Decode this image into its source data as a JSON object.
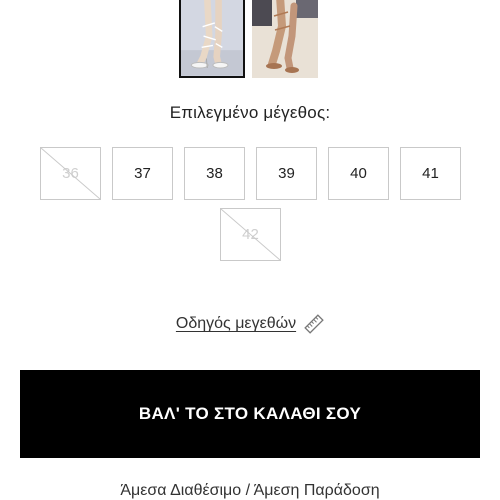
{
  "product": {
    "thumbnails": [
      {
        "icon": "sandal-photo-white",
        "selected": true
      },
      {
        "icon": "sandal-photo-nude",
        "selected": false
      }
    ]
  },
  "size_selector": {
    "title": "Επιλεγμένο μέγεθος:",
    "sizes": [
      {
        "label": "36",
        "available": false
      },
      {
        "label": "37",
        "available": true
      },
      {
        "label": "38",
        "available": true
      },
      {
        "label": "39",
        "available": true
      },
      {
        "label": "40",
        "available": true
      },
      {
        "label": "41",
        "available": true
      },
      {
        "label": "42",
        "available": false
      }
    ]
  },
  "size_guide": {
    "label": "Οδηγός μεγεθών",
    "icon": "ruler-icon"
  },
  "cart": {
    "button_label": "ΒΑΛ' ΤΟ ΣΤΟ ΚΑΛΑΘΙ ΣΟΥ"
  },
  "availability": {
    "text": "Άμεσα Διαθέσιμο / Άμεση Παράδοση"
  },
  "colors": {
    "button_bg": "#000000",
    "button_text": "#ffffff",
    "box_border": "#c9c9c9",
    "unavailable_text": "#cfcfcf"
  }
}
